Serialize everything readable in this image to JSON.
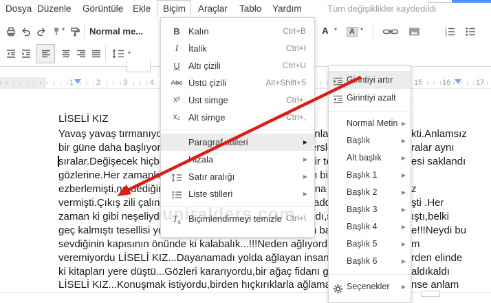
{
  "menubar": {
    "items": [
      "Dosya",
      "Düzenle",
      "Görüntüle",
      "Ekle",
      "Biçim",
      "Araçlar",
      "Tablo",
      "Yardım"
    ],
    "status": "Tüm değişiklikler kaydedildi"
  },
  "toolbar": {
    "style_dropdown": "Normal me...",
    "text_color_letter": "A",
    "highlight_letter": "A"
  },
  "ruler": {
    "numbers": [
      "1",
      "2",
      "3",
      "4",
      "15",
      "16",
      "17"
    ]
  },
  "format_menu": {
    "items": [
      {
        "label": "Kalın",
        "shortcut": "Ctrl+B"
      },
      {
        "label": "İtalik",
        "shortcut": "Ctrl+I"
      },
      {
        "label": "Altı çizili",
        "shortcut": "Ctrl+U"
      },
      {
        "label": "Üstü çizili",
        "shortcut": "Alt+Shift+5"
      },
      {
        "label": "Üst simge",
        "shortcut": "Ctrl+."
      },
      {
        "label": "Alt simge",
        "shortcut": "Ctrl+,"
      },
      {
        "label": "Paragraf stilleri",
        "shortcut": ""
      },
      {
        "label": "Hizala",
        "shortcut": ""
      },
      {
        "label": "Satır aralığı",
        "shortcut": ""
      },
      {
        "label": "Liste stilleri",
        "shortcut": ""
      },
      {
        "label": "Biçimlendirmeyi temizle",
        "shortcut": "Ctrl+\\"
      }
    ]
  },
  "paragraph_submenu": {
    "items": [
      "Girintiyi artır",
      "Girintiyi azalt",
      "Normal Metin",
      "Başlık",
      "Alt başlık",
      "Başlık 1",
      "Başlık 2",
      "Başlık 3",
      "Başlık 4",
      "Başlık 5",
      "Başlık 6",
      "Seçenekler"
    ]
  },
  "document": {
    "lines": [
      {
        "left": "LİSELİ KIZ",
        "right": ""
      },
      {
        "left": "Yavaş yavaş tırmanıyordu okulun yolunu,yine sıkıcı ve anlamsız bir gün daha başlayacaktı",
        "right": "kti.Anlamsız"
      },
      {
        "left": "bir güne daha başlıyordu işte,aynı okul,aynı sınıf,aynı dersler,aynı öğretmenler,sıralar aynı",
        "right": "ralar aynı"
      },
      {
        "left": "sıralar.Değişecek hiçbir şey yoktu,her şey aynıydı yine,bir tek o resim defterinin içine saklandı",
        "right": "esi saklandı"
      },
      {
        "left": "gözlerine.Her zamanki dersler,aynı konular,hepsini zaten biliyordu,hepsini çoktan",
        "right": ""
      },
      {
        "left": "ezberlemişti,ne dediğini duymuyordu öğretmenin,zil çalana kadar derse kulak bile",
        "right": "z"
      },
      {
        "left": "vermişti.Çıkış zili çalınca toplanıp çıktı okuldan,yürüdü caddeye doğru yavaşça",
        "right": "şti .Her"
      },
      {
        "left": "zaman ki gibi neşeliydi yolda,ama içinde garip bir his vardı,sanki bir şeyler olmuştu",
        "right": "ıştı,belki"
      },
      {
        "left": "geç kalmıştı tesellisi yoktu,adımlarını hızlandırdı,sokağın başına varınca gördü",
        "right": "e!!!Neydi bu"
      },
      {
        "left": "sevdiğinin kapısının önünde ki kalabalık...!!!Neden ağlıyordu bu insanlar,bir anlam",
        "right": "m"
      },
      {
        "left": "veremiyordu LİSELİ KIZ...Dayanamadı yolda ağlayan insanlara sordu,birden elinde",
        "right": "rden elinde"
      },
      {
        "left": "ki kitapları yere düştü...Gözleri kararıyordu,bir ağaç fidanı gibi yığıldıkaldı",
        "right": "aldıkaldı"
      },
      {
        "left": "LİSELİ KIZ...Konuşmak istiyordu,birden hıçkırıklarla ağlamaya başladı",
        "right": "nse anlam"
      }
    ]
  },
  "watermark": "uniralders.com",
  "icons": {
    "bold": "B",
    "italic": "I",
    "underline": "U",
    "strikethrough": "Abc",
    "superscript": "x²",
    "subscript": "x₂",
    "clear_t": "T",
    "clear_x": "x",
    "arrow": "▶",
    "caret": "▾"
  },
  "colors": {
    "annotation_arrow": "#dd1d12",
    "ruler_marker": "#79a5f2",
    "share_button": "#4d90fe"
  }
}
